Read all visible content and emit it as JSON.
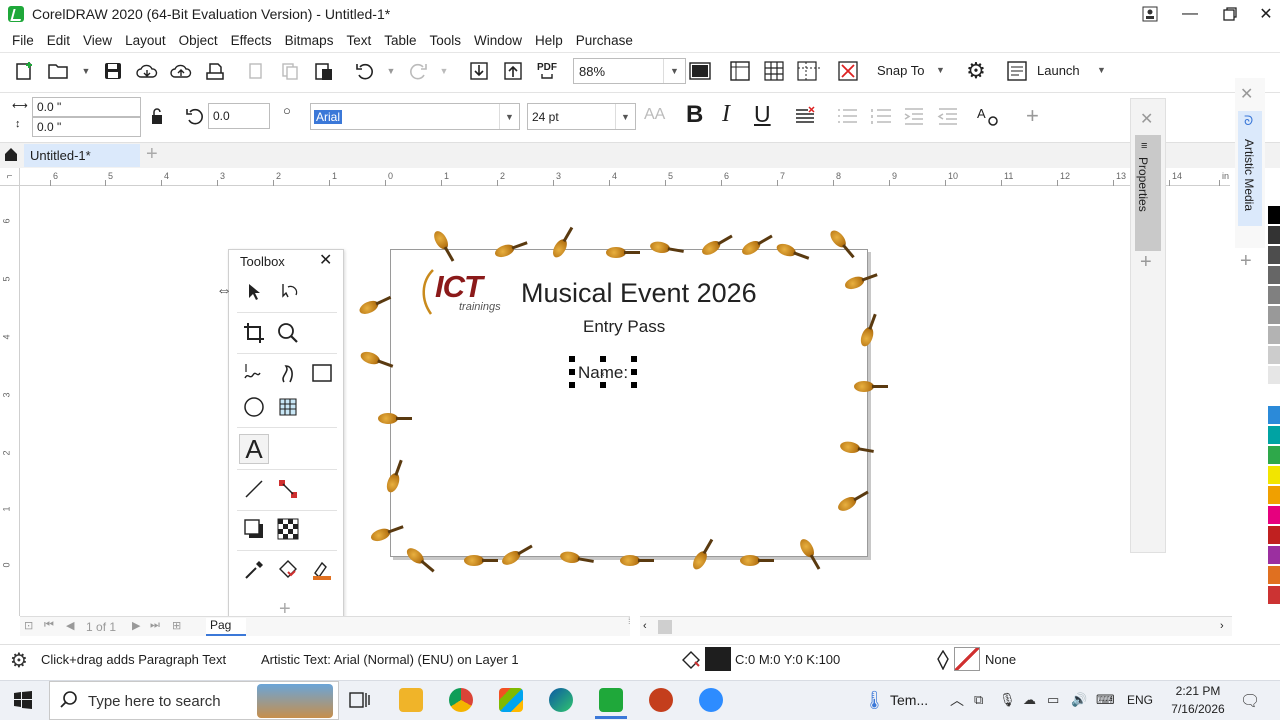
{
  "window": {
    "title": "CorelDRAW 2020 (64-Bit Evaluation Version) - Untitled-1*"
  },
  "menu": [
    "File",
    "Edit",
    "View",
    "Layout",
    "Object",
    "Effects",
    "Bitmaps",
    "Text",
    "Table",
    "Tools",
    "Window",
    "Help",
    "Purchase"
  ],
  "toolbar": {
    "zoom": "88%",
    "snap_to": "Snap To",
    "launch": "Launch",
    "pdf": "PDF"
  },
  "propbar": {
    "x": "0.0 \"",
    "y": "0.0 \"",
    "angle": "0.0",
    "font": "Arial",
    "size": "24 pt",
    "bold": "B",
    "italic": "I",
    "underline": "U"
  },
  "doc_tab": "Untitled-1*",
  "ruler_h": [
    "6",
    "5",
    "4",
    "3",
    "2",
    "1",
    "0",
    "1",
    "2",
    "3",
    "4",
    "5",
    "6",
    "7",
    "8",
    "9",
    "10",
    "11",
    "12",
    "13",
    "14",
    "in"
  ],
  "ruler_v": [
    "6",
    "5",
    "4",
    "3",
    "2",
    "1",
    "0"
  ],
  "design": {
    "logo_main": "ICT",
    "logo_sub": "trainings",
    "title": "Musical Event 2026",
    "subtitle": "Entry Pass",
    "name_field": "Name:"
  },
  "toolbox": {
    "title": "Toolbox"
  },
  "dockers": {
    "properties": "Properties",
    "artistic_media": "Artistic Media"
  },
  "page_nav": {
    "page_num": "1",
    "of": "of",
    "total": "1",
    "page_tab": "Pag"
  },
  "status": {
    "hint": "Click+drag adds Paragraph Text",
    "object_info": "Artistic Text: Arial (Normal) (ENU) on Layer 1",
    "fill": "C:0 M:0 Y:0 K:100",
    "outline": "None"
  },
  "taskbar": {
    "search_placeholder": "Type here to search",
    "weather": "Tem...",
    "lang": "ENG",
    "time": "2:21 PM",
    "date": "7/16/2026"
  },
  "colors": {
    "accent_blue": "#dbe9fb",
    "selected_font_bg": "#3b78d8",
    "violin": "#c8871e"
  }
}
